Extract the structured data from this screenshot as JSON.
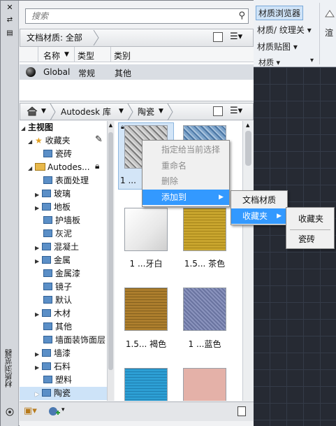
{
  "ribbon": {
    "items": [
      "材质浏览器",
      "材质/ 纹理关",
      "材质贴图",
      "材质",
      "渲"
    ],
    "arrows": [
      "▾",
      "▾",
      "▾",
      "▾"
    ]
  },
  "palette": {
    "side_title": "材质浏览器",
    "search_placeholder": "搜索",
    "doc_filter": "文档材质: 全部",
    "doc_columns": [
      "名称",
      "类型",
      "类别"
    ],
    "doc_rows": [
      {
        "name": "Global",
        "type": "常规",
        "category": "其他"
      }
    ],
    "library_breadcrumb": [
      "Autodesk 库",
      "陶瓷"
    ],
    "tree": {
      "root": "主视图",
      "favorites": "收藏夹",
      "fav_child": "瓷砖",
      "autodesk": "Autodes...",
      "items": [
        "表面处理",
        "玻璃",
        "地板",
        "护墙板",
        "灰泥",
        "混凝土",
        "金属",
        "金属漆",
        "镜子",
        "默认",
        "木材",
        "其他",
        "墙面装饰面层",
        "墙漆",
        "石料",
        "塑料",
        "陶瓷"
      ]
    },
    "swatches": [
      {
        "caption": "1 ..."
      },
      {
        "caption": ""
      },
      {
        "caption": "1 ...牙白"
      },
      {
        "caption": "1.5... 茶色"
      },
      {
        "caption": "1.5... 褐色"
      },
      {
        "caption": "1 ...蓝色"
      },
      {
        "caption": ""
      },
      {
        "caption": ""
      }
    ]
  },
  "context_menu": {
    "items": [
      "指定给当前选择",
      "重命名",
      "删除",
      "添加到"
    ]
  },
  "submenu1": {
    "items": [
      "文档材质",
      "收藏夹"
    ]
  },
  "submenu2": {
    "items": [
      "收藏夹",
      "瓷砖"
    ]
  }
}
